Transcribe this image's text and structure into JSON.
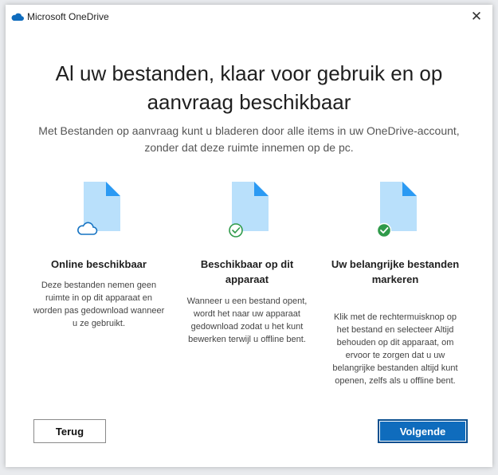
{
  "window": {
    "title": "Microsoft OneDrive",
    "close_glyph": "✕"
  },
  "main": {
    "headline": "Al uw bestanden, klaar voor gebruik en op aanvraag beschikbaar",
    "subtitle": "Met Bestanden op aanvraag kunt u bladeren door alle items in uw OneDrive-account, zonder dat deze ruimte innemen op de pc."
  },
  "features": [
    {
      "icon": "cloud-outline-icon",
      "title": "Online beschikbaar",
      "description": "Deze bestanden nemen geen ruimte in op dit apparaat en worden pas gedownload wanneer u ze gebruikt."
    },
    {
      "icon": "check-outline-icon",
      "title": "Beschikbaar op dit apparaat",
      "description": "Wanneer u een bestand opent, wordt het naar uw apparaat gedownload zodat u het kunt bewerken terwijl u offline bent."
    },
    {
      "icon": "check-filled-icon",
      "title": "Uw belangrijke bestanden markeren",
      "description": "Klik met de rechtermuisknop op het bestand en selecteer Altijd behouden op dit apparaat, om ervoor te zorgen dat u uw belangrijke bestanden altijd kunt openen, zelfs als u offline bent."
    }
  ],
  "buttons": {
    "back_label": "Terug",
    "next_label": "Volgende"
  },
  "colors": {
    "onedrive_blue": "#0f6cbd",
    "doc_light": "#b9e0fb",
    "doc_fold": "#2b9af3",
    "status_green": "#2f9a4a"
  }
}
